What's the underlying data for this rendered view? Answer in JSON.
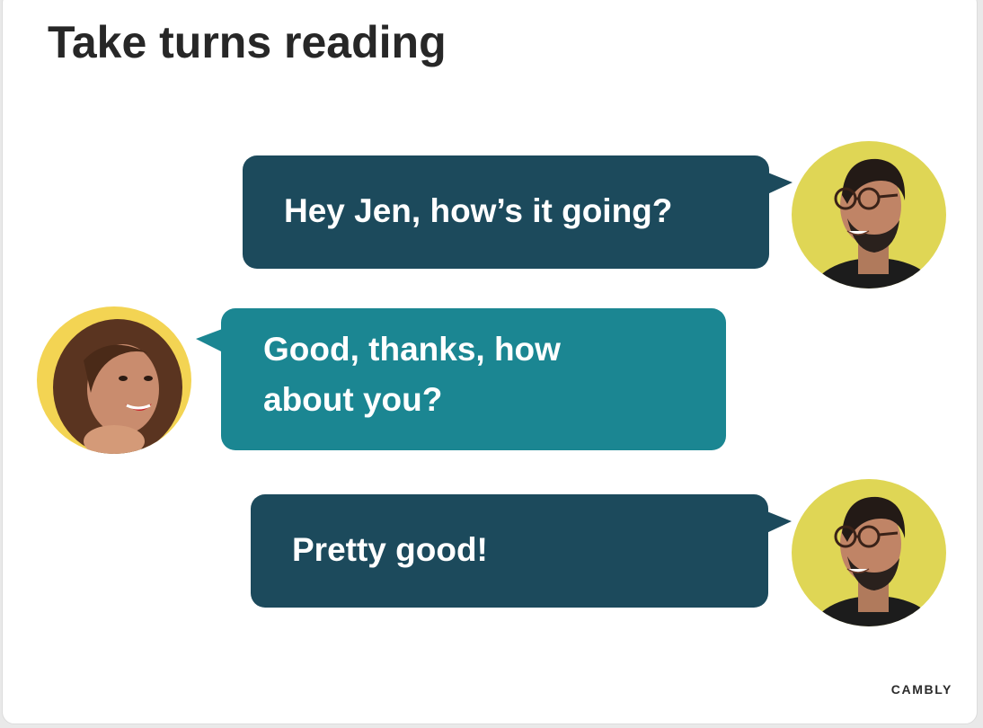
{
  "slide": {
    "title": "Take turns reading",
    "brand": "CAMBLY"
  },
  "messages": [
    {
      "speaker": "man",
      "text": "Hey Jen, how’s it going?"
    },
    {
      "speaker": "jen",
      "text": "Good, thanks, how\nabout you?"
    },
    {
      "speaker": "man",
      "text": "Pretty good!"
    }
  ],
  "colors": {
    "dark_bubble": "#1c4a5c",
    "teal_bubble": "#1b8692",
    "avatar_man_bg": "#dfd655",
    "avatar_woman_bg": "#f3d453"
  },
  "icons": {
    "avatar_man": "man-with-glasses-avatar",
    "avatar_woman": "smiling-woman-avatar"
  }
}
